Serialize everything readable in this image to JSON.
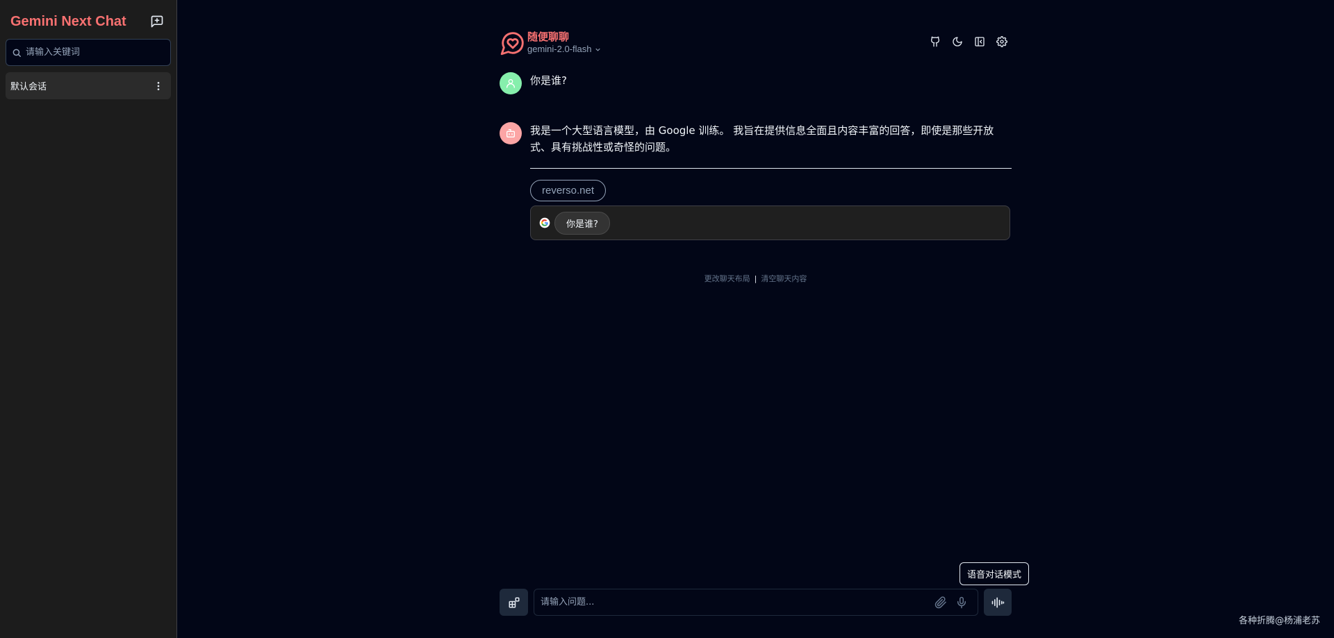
{
  "sidebar": {
    "app_title": "Gemini Next Chat",
    "new_chat_icon": "new-chat-icon",
    "search_placeholder": "请输入关键词",
    "conversations": [
      {
        "title": "默认会话"
      }
    ]
  },
  "header": {
    "assistant_name": "随便聊聊",
    "model": "gemini-2.0-flash",
    "tools": [
      "github-icon",
      "moon-icon",
      "panel-icon",
      "gear-icon"
    ]
  },
  "messages": [
    {
      "role": "user",
      "text": "你是谁?"
    },
    {
      "role": "model",
      "text": "我是一个大型语言模型，由 Google 训练。 我旨在提供信息全面且内容丰富的回答，即使是那些开放式、具有挑战性或奇怪的问题。",
      "source": "reverso.net",
      "search_suggestion": "你是谁?"
    }
  ],
  "footer_links": {
    "change_layout": "更改聊天布局",
    "separator": "|",
    "clear_chat": "清空聊天内容"
  },
  "composer": {
    "placeholder": "请输入问题...",
    "voice_tooltip": "语音对话模式"
  },
  "watermark": "各种折腾@杨浦老苏",
  "colors": {
    "accent": "#f87171",
    "background": "#020617",
    "sidebar": "#1c1c1c",
    "user_avatar": "#86efac",
    "bot_avatar": "#fca5a5"
  }
}
